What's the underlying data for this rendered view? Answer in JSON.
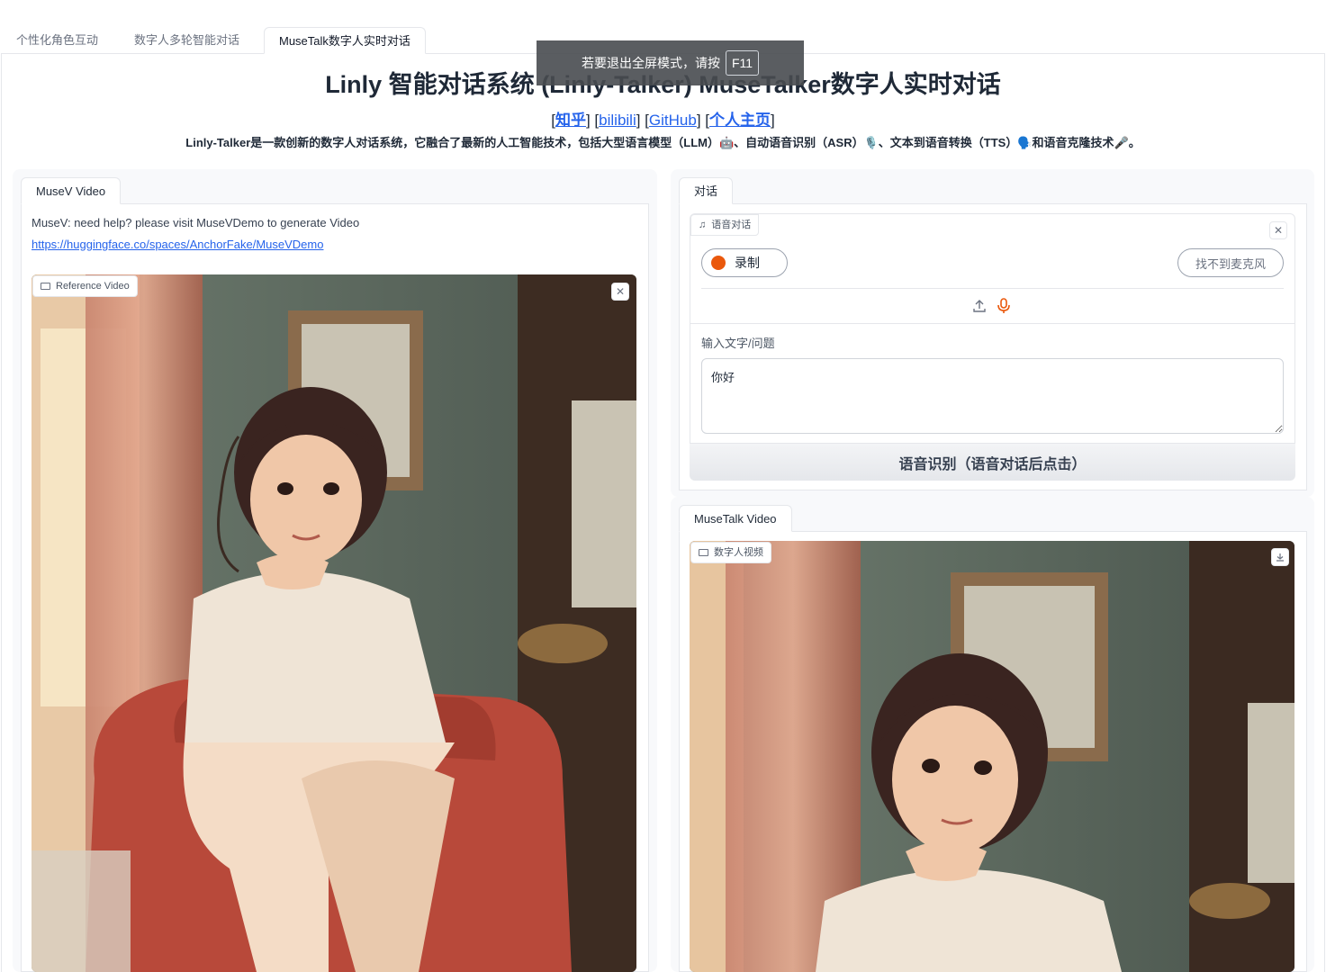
{
  "tabs": [
    {
      "label": "个性化角色互动",
      "active": false
    },
    {
      "label": "数字人多轮智能对话",
      "active": false
    },
    {
      "label": "MuseTalk数字人实时对话",
      "active": true
    }
  ],
  "toast": {
    "text": "若要退出全屏模式，请按",
    "key": "F11"
  },
  "header": {
    "title": "Linly 智能对话系统 (Linly-Talker) MuseTalker数字人实时对话",
    "links": [
      {
        "label": "知乎",
        "bold": true
      },
      {
        "label": "bilibili",
        "bold": false
      },
      {
        "label": "GitHub",
        "bold": false
      },
      {
        "label": "个人主页",
        "bold": true
      }
    ],
    "description": "Linly-Talker是一款创新的数字人对话系统，它融合了最新的人工智能技术，包括大型语言模型（LLM）🤖、自动语音识别（ASR）🎙️、文本到语音转换（TTS）🗣️和语音克隆技术🎤。"
  },
  "left_panel": {
    "tab_label": "MuseV Video",
    "help_text": "MuseV: need help? please visit MuseVDemo to generate Video",
    "help_link": "https://huggingface.co/spaces/AnchorFake/MuseVDemo",
    "video_label": "Reference Video",
    "close_icon": "close-icon"
  },
  "right_panel": {
    "tab_label": "对话",
    "audio_label": "语音对话",
    "record_label": "录制",
    "no_mic_label": "找不到麦克风",
    "text_label": "输入文字/问题",
    "text_value": "你好",
    "asr_button": "语音识别（语音对话后点击）"
  },
  "output_panel": {
    "tab_label": "MuseTalk Video",
    "video_label": "数字人视频",
    "download_icon": "download-icon"
  },
  "colors": {
    "link": "#2563eb",
    "record_dot": "#ea580c",
    "mic_icon": "#ea580c",
    "panel_bg": "#f8f9fb"
  }
}
